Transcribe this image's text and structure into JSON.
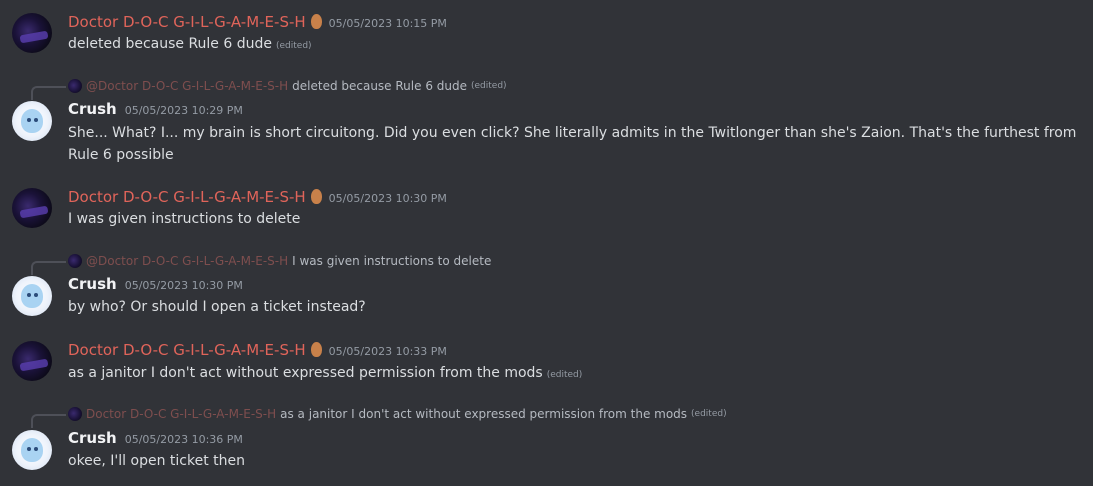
{
  "messages": [
    {
      "author": "Doctor D-O-C G-I-L-G-A-M-E-S-H",
      "timestamp": "05/05/2023 10:15 PM",
      "text": "deleted because Rule 6 dude",
      "edited": "(edited)"
    },
    {
      "reply_to": {
        "author": "@Doctor D-O-C G-I-L-G-A-M-E-S-H",
        "text": "deleted because Rule 6 dude",
        "edited": "(edited)"
      },
      "author": "Crush",
      "timestamp": "05/05/2023 10:29 PM",
      "text": "She... What? I... my brain is short circuitong. Did you even click? She literally admits in the Twitlonger than she's Zaion. That's the furthest from Rule 6 possible"
    },
    {
      "author": "Doctor D-O-C G-I-L-G-A-M-E-S-H",
      "timestamp": "05/05/2023 10:30 PM",
      "text": "I was given instructions to delete"
    },
    {
      "reply_to": {
        "author": "@Doctor D-O-C G-I-L-G-A-M-E-S-H",
        "text": "I was given instructions to delete"
      },
      "author": "Crush",
      "timestamp": "05/05/2023 10:30 PM",
      "text": "by who? Or should I open a ticket instead?"
    },
    {
      "author": "Doctor D-O-C G-I-L-G-A-M-E-S-H",
      "timestamp": "05/05/2023 10:33 PM",
      "text": "as a janitor I don't act without expressed permission from the mods",
      "edited": "(edited)"
    },
    {
      "reply_to": {
        "author": "Doctor D-O-C G-I-L-G-A-M-E-S-H",
        "text": "as a janitor I don't act without expressed permission from the mods",
        "edited": "(edited)"
      },
      "author": "Crush",
      "timestamp": "05/05/2023 10:36 PM",
      "text": "okee, I'll open ticket then"
    }
  ],
  "colors": {
    "background": "#313338",
    "doctor_name": "#e0645a",
    "crush_name": "#f2f3f5",
    "timestamp": "#949ba4"
  }
}
